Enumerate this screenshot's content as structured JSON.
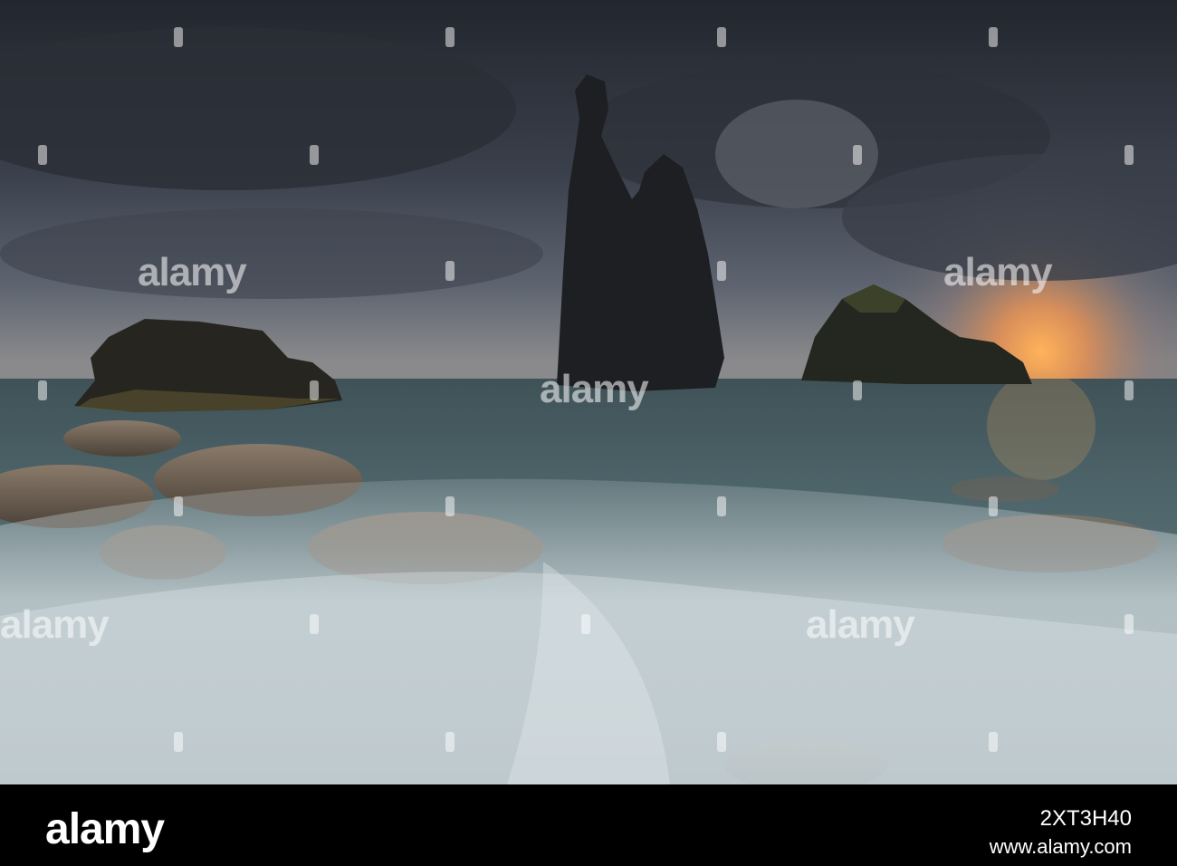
{
  "watermark": {
    "text": "alamy"
  },
  "footer": {
    "logo": "alamy",
    "image_id": "2XT3H40",
    "url": "www.alamy.com"
  }
}
